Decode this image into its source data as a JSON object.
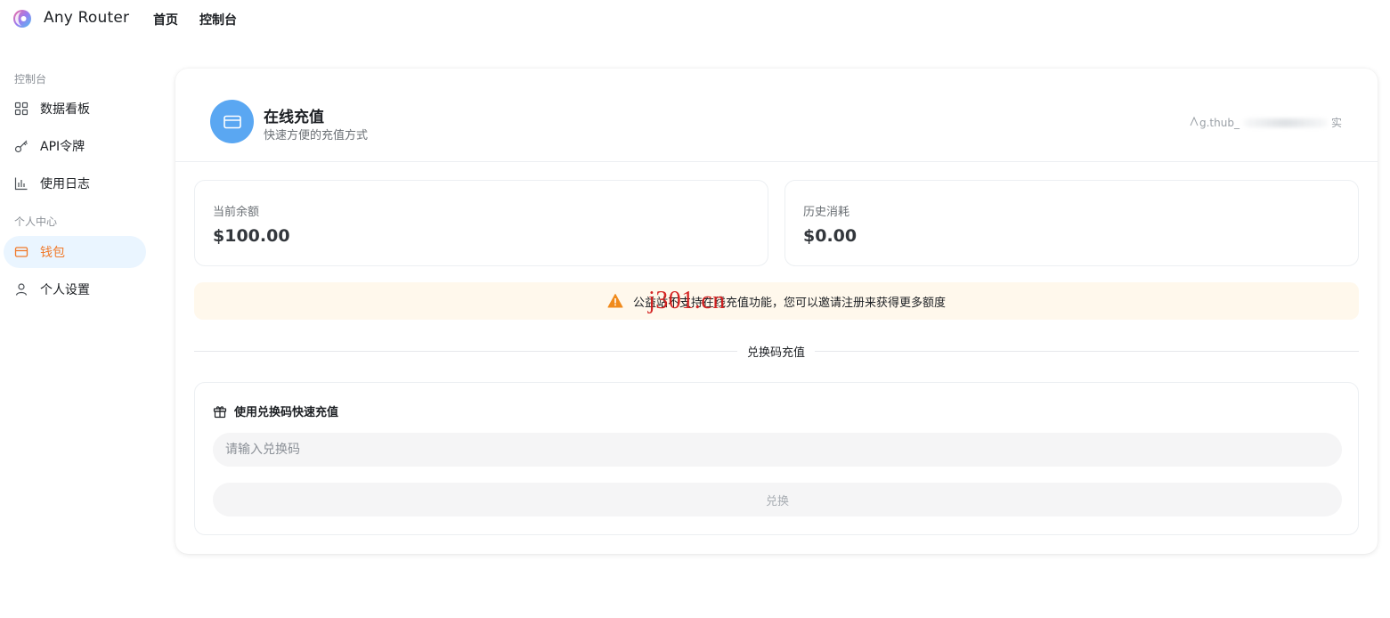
{
  "app": {
    "name": "Any Router"
  },
  "topnav": [
    {
      "label": "首页"
    },
    {
      "label": "控制台"
    }
  ],
  "sidebar": {
    "section_console": "控制台",
    "section_personal": "个人中心",
    "items": [
      {
        "label": "数据看板",
        "icon": "dashboard-icon"
      },
      {
        "label": "API令牌",
        "icon": "key-icon"
      },
      {
        "label": "使用日志",
        "icon": "bar-chart-icon"
      },
      {
        "label": "钱包",
        "icon": "wallet-icon",
        "active": true
      },
      {
        "label": "个人设置",
        "icon": "user-icon"
      }
    ]
  },
  "header": {
    "title": "在线充值",
    "subtitle": "快速方便的充值方式",
    "user_prefix": "g.thub_",
    "user_suffix": "实"
  },
  "stats": {
    "balance_label": "当前余额",
    "balance_value": "$100.00",
    "used_label": "历史消耗",
    "used_value": "$0.00"
  },
  "notice": {
    "text": "公益站不支持在线充值功能，您可以邀请注册来获得更多额度"
  },
  "divider": {
    "label": "兑换码充值"
  },
  "redeem": {
    "title": "使用兑换码快速充值",
    "placeholder": "请输入兑换码",
    "button": "兑换"
  },
  "watermark": "j301.cn",
  "colors": {
    "accent_blue": "#5aa7f2",
    "active_orange": "#f07a2b",
    "active_bg": "#eaf5ff",
    "notice_bg": "#fff8ec",
    "warning": "#f08a1c"
  }
}
